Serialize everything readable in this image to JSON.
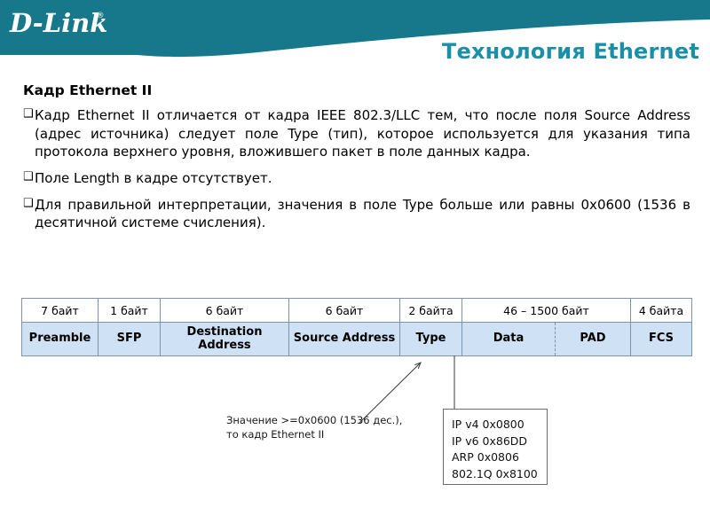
{
  "header": {
    "logo_text": "D-Link",
    "logo_trademark": "®",
    "title": "Технология Ethernet",
    "banner_color": "#18788b",
    "title_color": "#1a8fa8"
  },
  "content": {
    "heading": "Кадр Ethernet II",
    "bullet_glyph": "❑",
    "bullets": [
      "Кадр Ethernet II отличается от кадра IEEE 802.3/LLC тем, что после поля Source Address (адрес источника) следует поле Type (тип), которое используется для указания типа протокола верхнего уровня, вложившего пакет в поле данных кадра.",
      "Поле Length в кадре отсутствует.",
      "Для правильной интерпретации, значения в поле Type больше или равны 0x0600 (1536 в десятичной системе счисления)."
    ]
  },
  "frame_table": {
    "header_row_color": "#ffffff",
    "field_row_color": "#cfe2f5",
    "border_color": "#7c94ab",
    "sizes": [
      "7 байт",
      "1 байт",
      "6 байт",
      "6 байт",
      "2 байта",
      "46 – 1500 байт",
      "4 байта"
    ],
    "fields": [
      "Preamble",
      "SFP",
      "Destination Address",
      "Source Address",
      "Type",
      "Data",
      "PAD",
      "FCS"
    ]
  },
  "annotations": {
    "type_note_line1": "Значение >=0x0600 (1536 дес.),",
    "type_note_line2": "то кадр Ethernet II",
    "ethertype_values": [
      "IP v4 0x0800",
      "IP v6 0x86DD",
      "ARP 0x0806",
      "802.1Q 0x8100"
    ]
  }
}
